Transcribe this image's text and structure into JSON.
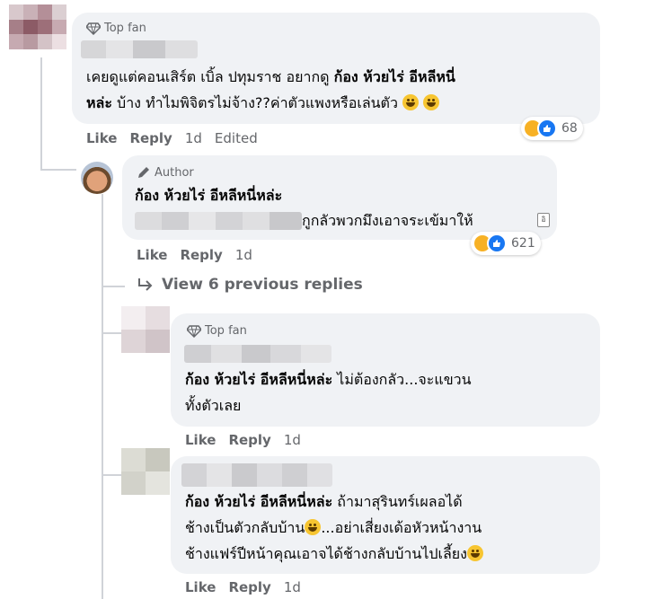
{
  "comments": [
    {
      "badge": "Top fan",
      "line1": "เคยดูแต่คอนเสิร์ต เบิ้ล ปทุมราช อยากดู ",
      "line1_bold": "ก้อง ห้วยไร่ อีหลีหนี่",
      "line2_bold": "หล่ะ",
      "line2": " บ้าง ทำไมพิจิตรไม่จ้าง??ค่าตัวแพงหรือเล่นตัว",
      "actions": {
        "like": "Like",
        "reply": "Reply",
        "time": "1d",
        "edited": "Edited"
      },
      "reactions": {
        "count": "68",
        "types": [
          "haha-icon",
          "like-icon"
        ]
      }
    },
    {
      "badge": "Author",
      "name": "ก้อง ห้วยไร่ อีหลีหนี่หล่ะ",
      "line": "กูกลัวพวกมึงเอาจระเข้มาให้",
      "actions": {
        "like": "Like",
        "reply": "Reply",
        "time": "1d"
      },
      "reactions": {
        "count": "621",
        "types": [
          "haha-icon",
          "like-icon"
        ]
      }
    },
    {
      "view_replies": "View 6 previous replies"
    },
    {
      "badge": "Top fan",
      "line1_bold": "ก้อง ห้วยไร่ อีหลีหนี่หล่ะ",
      "line1": " ไม่ต้องกลัว...จะแขวน",
      "line2": "ทั้งตัวเลย",
      "actions": {
        "like": "Like",
        "reply": "Reply",
        "time": "1d"
      }
    },
    {
      "line1_bold": "ก้อง ห้วยไร่ อีหลีหนี่หล่ะ",
      "line1": " ถ้ามาสุรินทร์เผลอได้",
      "line2a": "ช้างเป็นตัวกลับบ้าน",
      "line2b": "...อย่าเสี่ยงเด้อหัวหน้างาน",
      "line3": "ช้างแฟร์ปีหน้าคุณเอาจได้ช้างกลับบ้านไปเลี้ยง",
      "actions": {
        "like": "Like",
        "reply": "Reply",
        "time": "1d"
      }
    }
  ],
  "colors": {
    "bubble": "#f0f2f5",
    "meta": "#65676b",
    "text": "#050505",
    "like_blue": "#1877f2",
    "haha_yellow": "#f7b125"
  }
}
